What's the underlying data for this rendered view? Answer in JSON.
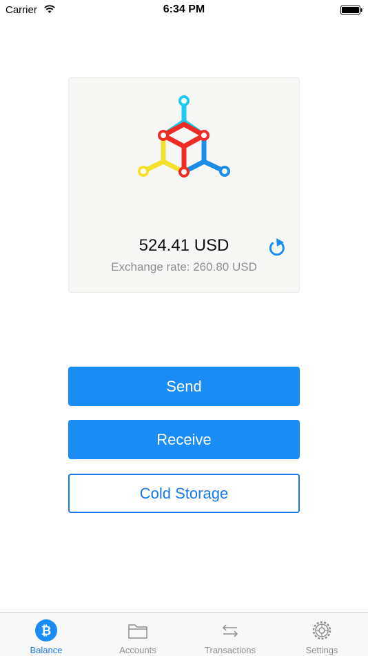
{
  "status_bar": {
    "carrier": "Carrier",
    "time": "6:34 PM",
    "wifi_icon": "wifi-icon",
    "battery_icon": "battery-icon"
  },
  "balance_card": {
    "logo_icon": "mycelium-logo",
    "logo_colors": [
      "#1ccbf2",
      "#f4e12b",
      "#ee2b24",
      "#1b8de6"
    ],
    "amount": "524.41 USD",
    "exchange_rate": "Exchange rate: 260.80 USD",
    "refresh_icon": "refresh-icon"
  },
  "actions": {
    "send_label": "Send",
    "receive_label": "Receive",
    "cold_storage_label": "Cold Storage"
  },
  "tab_bar": {
    "active": "Balance",
    "items": [
      {
        "label": "Balance",
        "icon": "bitcoin-icon"
      },
      {
        "label": "Accounts",
        "icon": "folder-icon"
      },
      {
        "label": "Transactions",
        "icon": "transfer-arrows-icon"
      },
      {
        "label": "Settings",
        "icon": "gear-icon"
      }
    ]
  },
  "colors": {
    "accent": "#1a8cf5",
    "outline_accent": "#1a78e5",
    "muted_text": "#8e8e8e"
  }
}
